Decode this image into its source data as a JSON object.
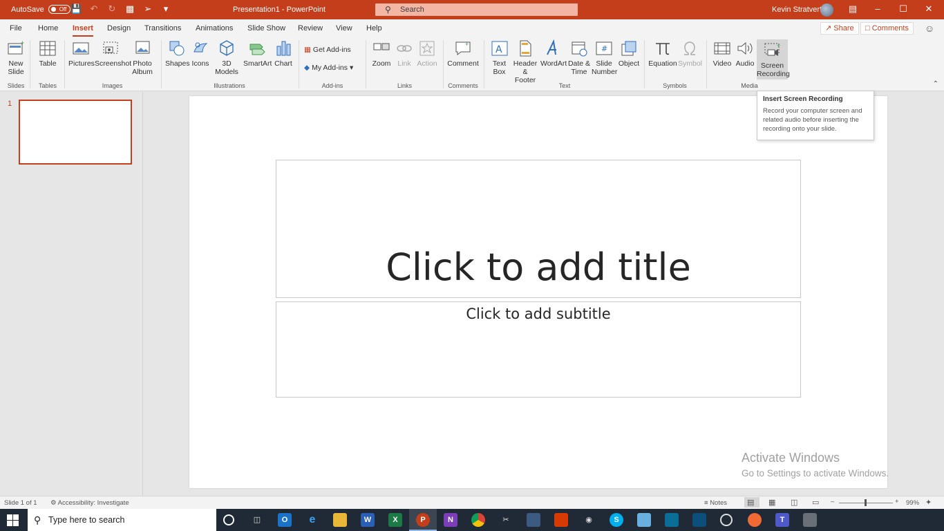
{
  "titlebar": {
    "autosave_label": "AutoSave",
    "autosave_state": "Off",
    "document_title": "Presentation1 - PowerPoint",
    "search_placeholder": "Search",
    "user_name": "Kevin Stratvert"
  },
  "tabs": [
    "File",
    "Home",
    "Insert",
    "Design",
    "Transitions",
    "Animations",
    "Slide Show",
    "Review",
    "View",
    "Help"
  ],
  "active_tab": "Insert",
  "share_label": "Share",
  "comments_label": "Comments",
  "ribbon": {
    "new_slide": "New Slide",
    "table": "Table",
    "pictures": "Pictures",
    "screenshot": "Screenshot",
    "photo_album": "Photo Album",
    "shapes": "Shapes",
    "icons": "Icons",
    "models_3d": "3D Models",
    "smartart": "SmartArt",
    "chart": "Chart",
    "get_addins": "Get Add-ins",
    "my_addins": "My Add-ins",
    "zoom": "Zoom",
    "link": "Link",
    "action": "Action",
    "comment": "Comment",
    "text_box": "Text Box",
    "header_footer": "Header & Footer",
    "wordart": "WordArt",
    "date_time": "Date & Time",
    "slide_number": "Slide Number",
    "object": "Object",
    "equation": "Equation",
    "symbol": "Symbol",
    "video": "Video",
    "audio": "Audio",
    "screen_recording": "Screen Recording",
    "groups": {
      "slides": "Slides",
      "tables": "Tables",
      "images": "Images",
      "illustrations": "Illustrations",
      "addins": "Add-ins",
      "links": "Links",
      "comments": "Comments",
      "text": "Text",
      "symbols": "Symbols",
      "media": "Media"
    }
  },
  "tooltip": {
    "title": "Insert Screen Recording",
    "body": "Record your computer screen and related audio before inserting the recording onto your slide."
  },
  "thumbnails": [
    {
      "number": "1"
    }
  ],
  "slide": {
    "title_placeholder": "Click to add title",
    "subtitle_placeholder": "Click to add subtitle"
  },
  "watermark": {
    "line1": "Activate Windows",
    "line2": "Go to Settings to activate Windows."
  },
  "statusbar": {
    "slide_info": "Slide 1 of 1",
    "accessibility": "Accessibility: Investigate",
    "notes": "Notes",
    "zoom_level": "99%",
    "zoom_fraction": 0.49
  },
  "taskbar": {
    "search_placeholder": "Type here to search"
  },
  "colors": {
    "accent": "#c43e1c",
    "taskbar": "#1f2a36"
  }
}
